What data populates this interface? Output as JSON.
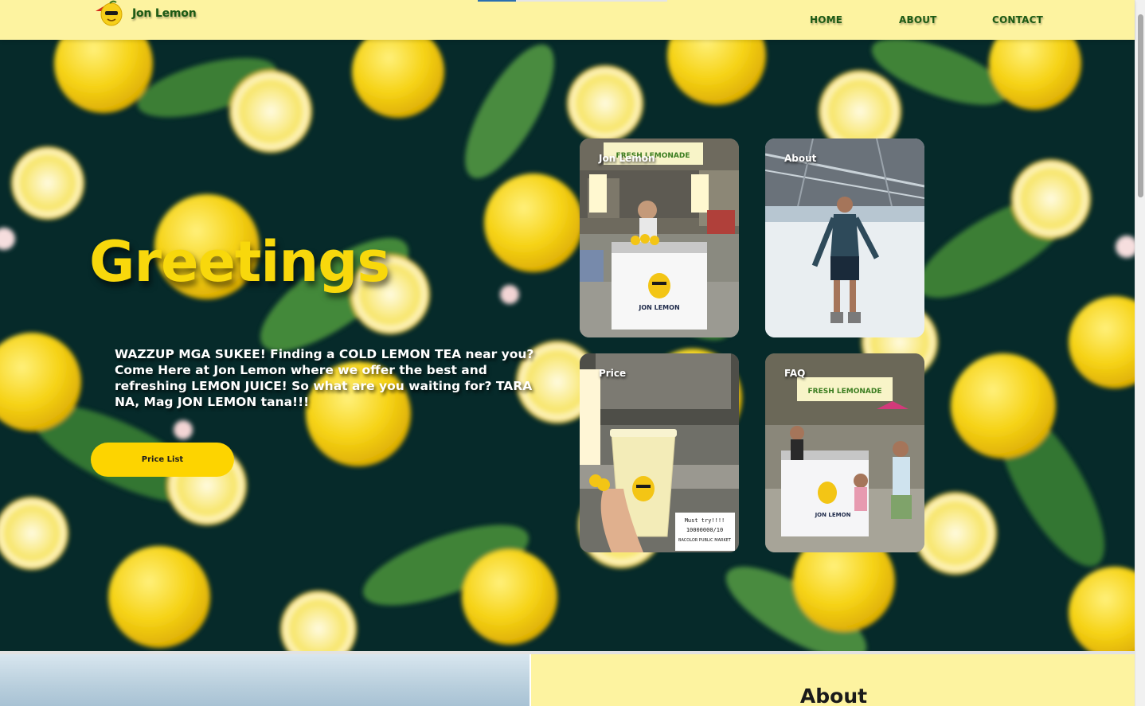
{
  "brand": {
    "name": "Jon Lemon",
    "logo_icon": "lemon-mascot-icon"
  },
  "nav": {
    "home": "HOME",
    "about": "ABOUT",
    "contact": "CONTACT"
  },
  "hero": {
    "heading": "Greetings",
    "description": "WAZZUP MGA SUKEE! Finding a COLD LEMON TEA near you? Come Here at Jon Lemon where we offer the best and refreshing LEMON JUICE! So what are you waiting for? TARA NA, Mag JON LEMON tana!!!",
    "button_label": "Price List"
  },
  "cards": [
    {
      "label": "Jon Lemon",
      "photo": "lemonade-stall-photo"
    },
    {
      "label": "About",
      "photo": "ice-skating-photo"
    },
    {
      "label": "Price",
      "photo": "lemon-drink-cup-photo"
    },
    {
      "label": "FAQ",
      "photo": "stall-with-children-photo"
    }
  ],
  "about_section": {
    "title": "About"
  },
  "colors": {
    "header_bg": "#fdf3a0",
    "brand_green": "#1c5a14",
    "heading_yellow": "#f8d80c",
    "button_yellow": "#fdd400",
    "hero_bg": "#062a2a"
  }
}
